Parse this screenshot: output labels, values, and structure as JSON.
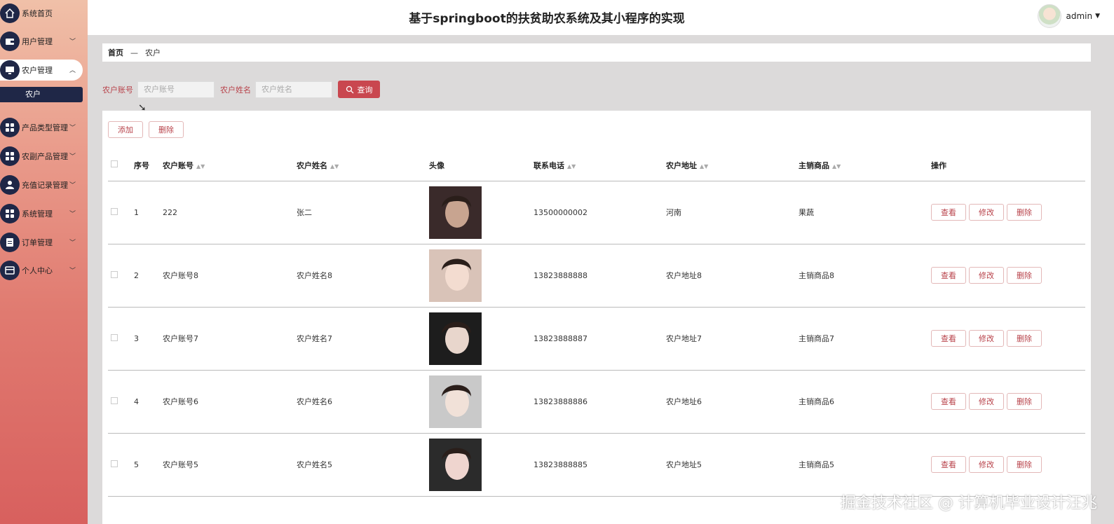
{
  "header": {
    "title": "基于springboot的扶贫助农系统及其小程序的实现",
    "user": "admin"
  },
  "sidebar": {
    "items": [
      {
        "label": "系统首页",
        "icon": "home-icon"
      },
      {
        "label": "用户管理",
        "icon": "wallet-icon"
      },
      {
        "label": "农户管理",
        "icon": "monitor-icon"
      },
      {
        "label": "产品类型管理",
        "icon": "grid-icon"
      },
      {
        "label": "农副产品管理",
        "icon": "grid-icon"
      },
      {
        "label": "充值记录管理",
        "icon": "person-icon"
      },
      {
        "label": "系统管理",
        "icon": "grid-icon"
      },
      {
        "label": "订单管理",
        "icon": "clipboard-icon"
      },
      {
        "label": "个人中心",
        "icon": "card-icon"
      }
    ],
    "sub_item": "农户"
  },
  "breadcrumb": {
    "home": "首页",
    "sep": "—",
    "current": "农户"
  },
  "search": {
    "account_label": "农户账号",
    "account_placeholder": "农户账号",
    "name_label": "农户姓名",
    "name_placeholder": "农户姓名",
    "query_label": "查询"
  },
  "toolbar": {
    "add_label": "添加",
    "delete_label": "删除"
  },
  "table": {
    "headers": [
      "序号",
      "农户账号",
      "农户姓名",
      "头像",
      "联系电话",
      "农户地址",
      "主销商品",
      "操作"
    ],
    "rows": [
      {
        "no": "1",
        "account": "222",
        "name": "张二",
        "phone": "13500000002",
        "address": "河南",
        "product": "果蔬"
      },
      {
        "no": "2",
        "account": "农户账号8",
        "name": "农户姓名8",
        "phone": "13823888888",
        "address": "农户地址8",
        "product": "主销商品8"
      },
      {
        "no": "3",
        "account": "农户账号7",
        "name": "农户姓名7",
        "phone": "13823888887",
        "address": "农户地址7",
        "product": "主销商品7"
      },
      {
        "no": "4",
        "account": "农户账号6",
        "name": "农户姓名6",
        "phone": "13823888886",
        "address": "农户地址6",
        "product": "主销商品6"
      },
      {
        "no": "5",
        "account": "农户账号5",
        "name": "农户姓名5",
        "phone": "13823888885",
        "address": "农户地址5",
        "product": "主销商品5"
      }
    ],
    "ops": {
      "view": "查看",
      "edit": "修改",
      "delete": "删除"
    }
  },
  "watermark": "掘金技术社区 @ 计算机毕业设计汪兆"
}
